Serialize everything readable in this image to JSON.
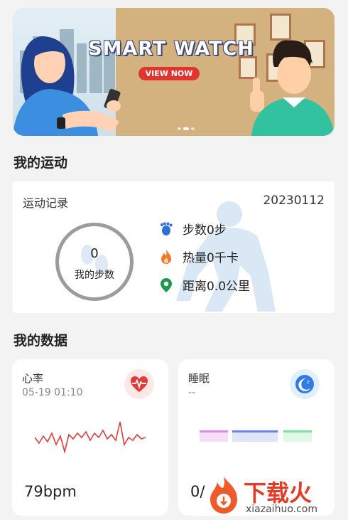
{
  "banner": {
    "title": "SMART WATCH",
    "cta": "VIEW NOW"
  },
  "sections": {
    "my_exercise": "我的运动",
    "my_data": "我的数据"
  },
  "exercise": {
    "label": "运动记录",
    "date": "20230112",
    "steps_value": "0",
    "steps_label": "我的步数",
    "stats": [
      {
        "icon": "footprints-icon",
        "text": "步数0步",
        "color": "#2f6fd9"
      },
      {
        "icon": "flame-icon",
        "text": "热量0千卡",
        "color": "#f0782a"
      },
      {
        "icon": "location-pin-icon",
        "text": "距离0.0公里",
        "color": "#1a9a4a"
      }
    ]
  },
  "heart_rate": {
    "title": "心率",
    "time": "05-19 01:10",
    "value": "79bpm",
    "color": "#e23b3b"
  },
  "sleep": {
    "title": "睡眠",
    "time": "--",
    "value": "0/",
    "bar_colors": [
      "#e784e8",
      "#6b83e6",
      "#79e29b"
    ]
  },
  "watermark": {
    "text": "下载火",
    "url": "xiazaihuo.com"
  }
}
